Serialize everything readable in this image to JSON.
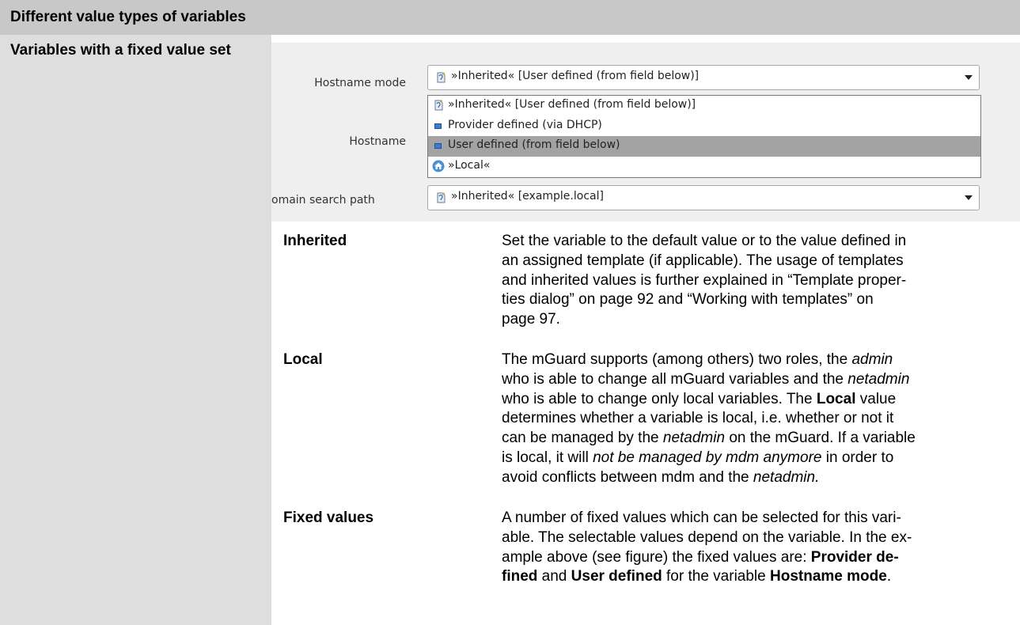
{
  "header": {
    "title": "Different value types of variables"
  },
  "sidebar": {
    "title": "Variables with a fixed value set"
  },
  "screenshot": {
    "fields": {
      "hostname_mode_label": "Hostname mode",
      "hostname_label": "Hostname",
      "domain_search_path_label": "omain search path"
    },
    "hostname_mode_combo": {
      "value": "»Inherited« [User defined (from field below)]"
    },
    "dropdown": {
      "options": [
        {
          "label": "»Inherited« [User defined (from field below)]",
          "icon": "inherited-icon"
        },
        {
          "label": "Provider defined (via DHCP)",
          "icon": "value-square-icon"
        },
        {
          "label": "User defined (from field below)",
          "icon": "value-square-icon",
          "selected": true
        },
        {
          "label": "»Local«",
          "icon": "local-house-icon"
        }
      ]
    },
    "domain_search_combo": {
      "value": "»Inherited« [example.local]"
    }
  },
  "definitions": {
    "inherited": {
      "term": "Inherited",
      "lines": [
        "Set the variable to the default value or to the value defined in",
        "an assigned template (if applicable). The usage of templates",
        "and inherited values is further explained in “Template proper-",
        "ties dialog” on page 92 and “Working with templates” on",
        "page 97."
      ]
    },
    "local": {
      "term": "Local",
      "l1a": "The mGuard supports (among others) two roles, the ",
      "l1b": "admin",
      "l2a": "who is able to change all mGuard variables and the ",
      "l2b": "netadmin",
      "l3a": "who is able to change only local variables. The ",
      "l3b": "Local",
      "l3c": " value",
      "l4": "determines whether a variable is local, i.e. whether or not it",
      "l5a": "can be managed by the ",
      "l5b": "netadmin",
      "l5c": " on the mGuard. If a variable",
      "l6a": "is local, it will ",
      "l6b": "not be managed by mdm anymore",
      "l6c": " in order to",
      "l7a": "avoid conflicts between mdm and the ",
      "l7b": "netadmin."
    },
    "fixed": {
      "term": "Fixed values",
      "l1": "A number of fixed values which can be selected for this vari-",
      "l2": "able. The selectable values depend on the variable. In the ex-",
      "l3a": "ample above (see figure) the fixed values are: ",
      "l3b": "Provider de-",
      "l4a": "fined",
      "l4b": " and ",
      "l4c": "User defined",
      "l4d": " for the variable ",
      "l4e": "Hostname mode",
      "l4f": "."
    }
  }
}
